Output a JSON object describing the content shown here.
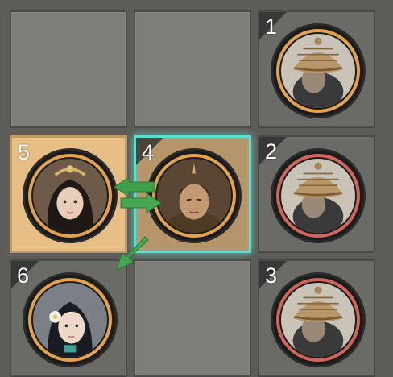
{
  "board": {
    "slots": [
      {
        "id": "slot-1",
        "number": "1",
        "unit": "helmet-soldier",
        "team": "ally"
      },
      {
        "id": "slot-2",
        "number": "2",
        "unit": "helmet-soldier",
        "team": "enemy"
      },
      {
        "id": "slot-3",
        "number": "3",
        "unit": "helmet-soldier",
        "team": "enemy"
      },
      {
        "id": "slot-4",
        "number": "4",
        "unit": "warrior-hero",
        "team": "ally",
        "state": "selected"
      },
      {
        "id": "slot-5",
        "number": "5",
        "unit": "lady-hero",
        "team": "ally",
        "state": "swap-target"
      },
      {
        "id": "slot-6",
        "number": "6",
        "unit": "maiden-hero",
        "team": "ally"
      }
    ]
  },
  "colors": {
    "ally_ring": "#e3a34e",
    "enemy_ring": "#d0665b",
    "selected_border": "#59e0cf",
    "move_arrow": "#3f9f4a",
    "target_bg": "#e7bf86"
  },
  "icons": [
    "helmet-soldier-icon",
    "warrior-hero-icon",
    "lady-hero-icon",
    "maiden-hero-icon",
    "swap-arrow-icon",
    "move-arrow-icon"
  ]
}
